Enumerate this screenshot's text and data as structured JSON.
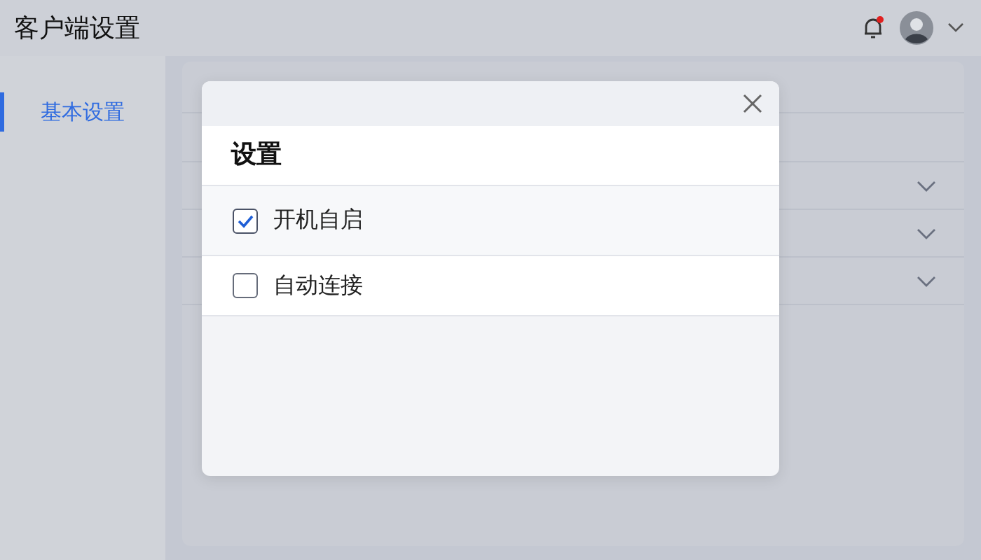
{
  "header": {
    "title": "客户端设置",
    "notification_unread": true
  },
  "sidebar": {
    "items": [
      {
        "label": "基本设置",
        "selected": true
      }
    ]
  },
  "panel": {
    "sections": [
      {
        "expanded": false
      },
      {
        "expanded": false
      },
      {
        "expanded": false
      }
    ]
  },
  "dialog": {
    "title": "设置",
    "options": [
      {
        "label": "开机自启",
        "checked": true
      },
      {
        "label": "自动连接",
        "checked": false
      }
    ]
  }
}
